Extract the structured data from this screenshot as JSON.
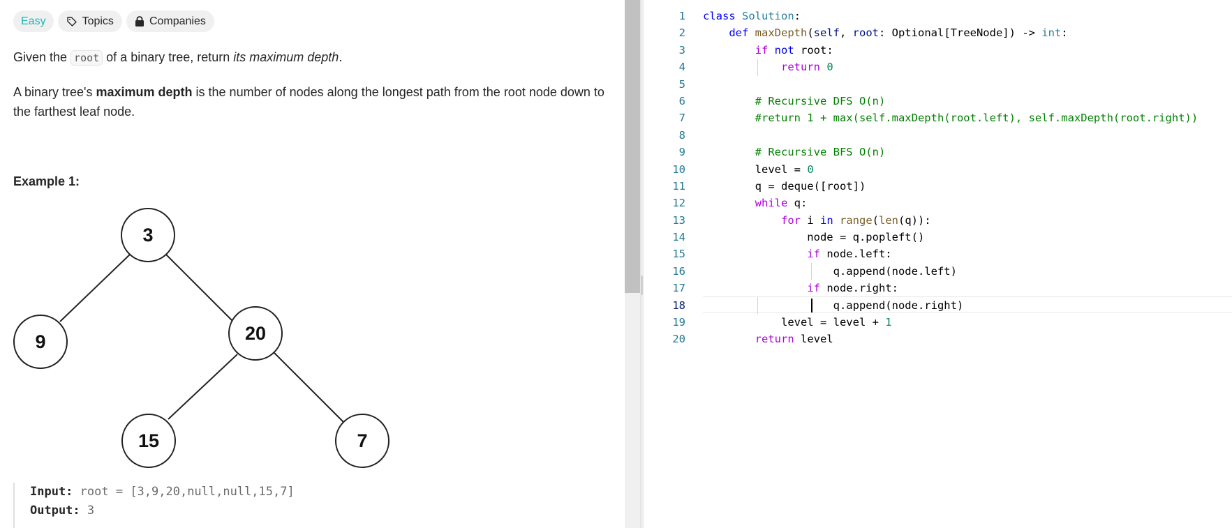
{
  "tags": {
    "difficulty": "Easy",
    "topics": "Topics",
    "companies": "Companies"
  },
  "description": {
    "p1_start": "Given the ",
    "p1_code": "root",
    "p1_mid": " of a binary tree, return ",
    "p1_em": "its maximum depth",
    "p1_end": ".",
    "p2_start": "A binary tree's ",
    "p2_bold": "maximum depth",
    "p2_end": " is the number of nodes along the longest path from the root node down to the farthest leaf node."
  },
  "example": {
    "title": "Example 1:",
    "tree_nodes": [
      "3",
      "9",
      "20",
      "15",
      "7"
    ],
    "input_label": "Input:",
    "input_value": "root = [3,9,20,null,null,15,7]",
    "output_label": "Output:",
    "output_value": "3"
  },
  "editor": {
    "active_line": 18,
    "line_numbers": [
      "1",
      "2",
      "3",
      "4",
      "5",
      "6",
      "7",
      "8",
      "9",
      "10",
      "11",
      "12",
      "13",
      "14",
      "15",
      "16",
      "17",
      "18",
      "19",
      "20"
    ]
  }
}
